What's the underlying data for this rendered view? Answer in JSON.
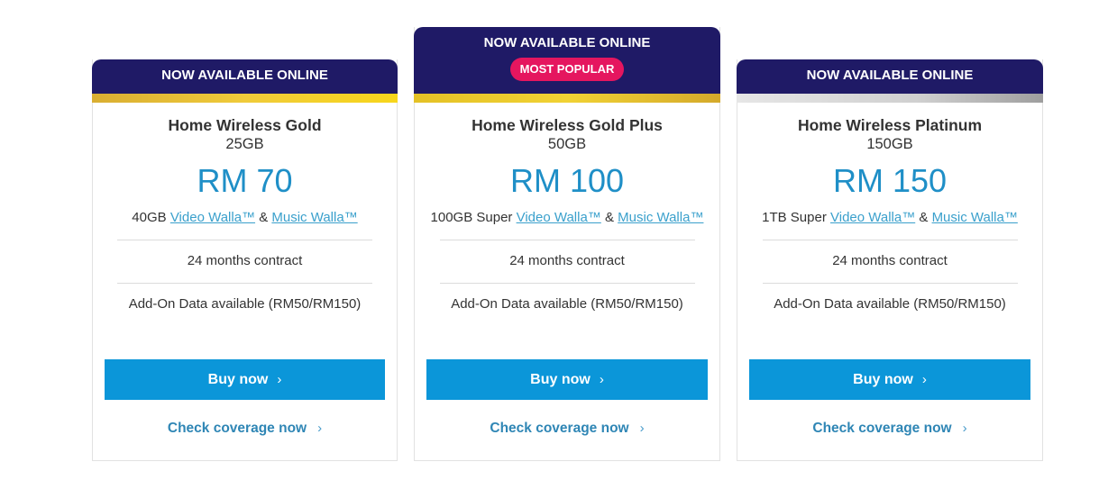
{
  "colors": {
    "header_bg": "#1f1a66",
    "badge_bg": "#e5165f",
    "price": "#1f8fc7",
    "button_bg": "#0b96d9",
    "link": "#3aa0cc",
    "gold_stripe": "#f0cb3a",
    "silver_stripe": "#cfcfcf"
  },
  "plans": [
    {
      "header": "NOW AVAILABLE ONLINE",
      "badge": null,
      "stripe": "gold",
      "name": "Home Wireless Gold",
      "quota": "25GB",
      "price": "RM 70",
      "feature_prefix": "40GB ",
      "video_link": "Video Walla™",
      "amp": " & ",
      "music_link": "Music Walla™",
      "contract": "24 months contract",
      "addon": "Add-On Data available (RM50/RM150)",
      "buy_label": "Buy now",
      "coverage_label": "Check coverage now",
      "chevron_icon": "chevron-right-icon"
    },
    {
      "header": "NOW AVAILABLE ONLINE",
      "badge": "MOST POPULAR",
      "stripe": "gold",
      "name": "Home Wireless Gold Plus",
      "quota": "50GB",
      "price": "RM 100",
      "feature_prefix": "100GB Super ",
      "video_link": "Video Walla™",
      "amp": " & ",
      "music_link": "Music Walla™",
      "contract": "24 months contract",
      "addon": "Add-On Data available (RM50/RM150)",
      "buy_label": "Buy now",
      "coverage_label": "Check coverage now",
      "chevron_icon": "chevron-right-icon"
    },
    {
      "header": "NOW AVAILABLE ONLINE",
      "badge": null,
      "stripe": "silver",
      "name": "Home Wireless Platinum",
      "quota": "150GB",
      "price": "RM 150",
      "feature_prefix": "1TB Super ",
      "video_link": "Video Walla™",
      "amp": " & ",
      "music_link": "Music Walla™",
      "contract": "24 months contract",
      "addon": "Add-On Data available (RM50/RM150)",
      "buy_label": "Buy now",
      "coverage_label": "Check coverage now",
      "chevron_icon": "chevron-right-icon"
    }
  ],
  "chevron_glyph": "›"
}
